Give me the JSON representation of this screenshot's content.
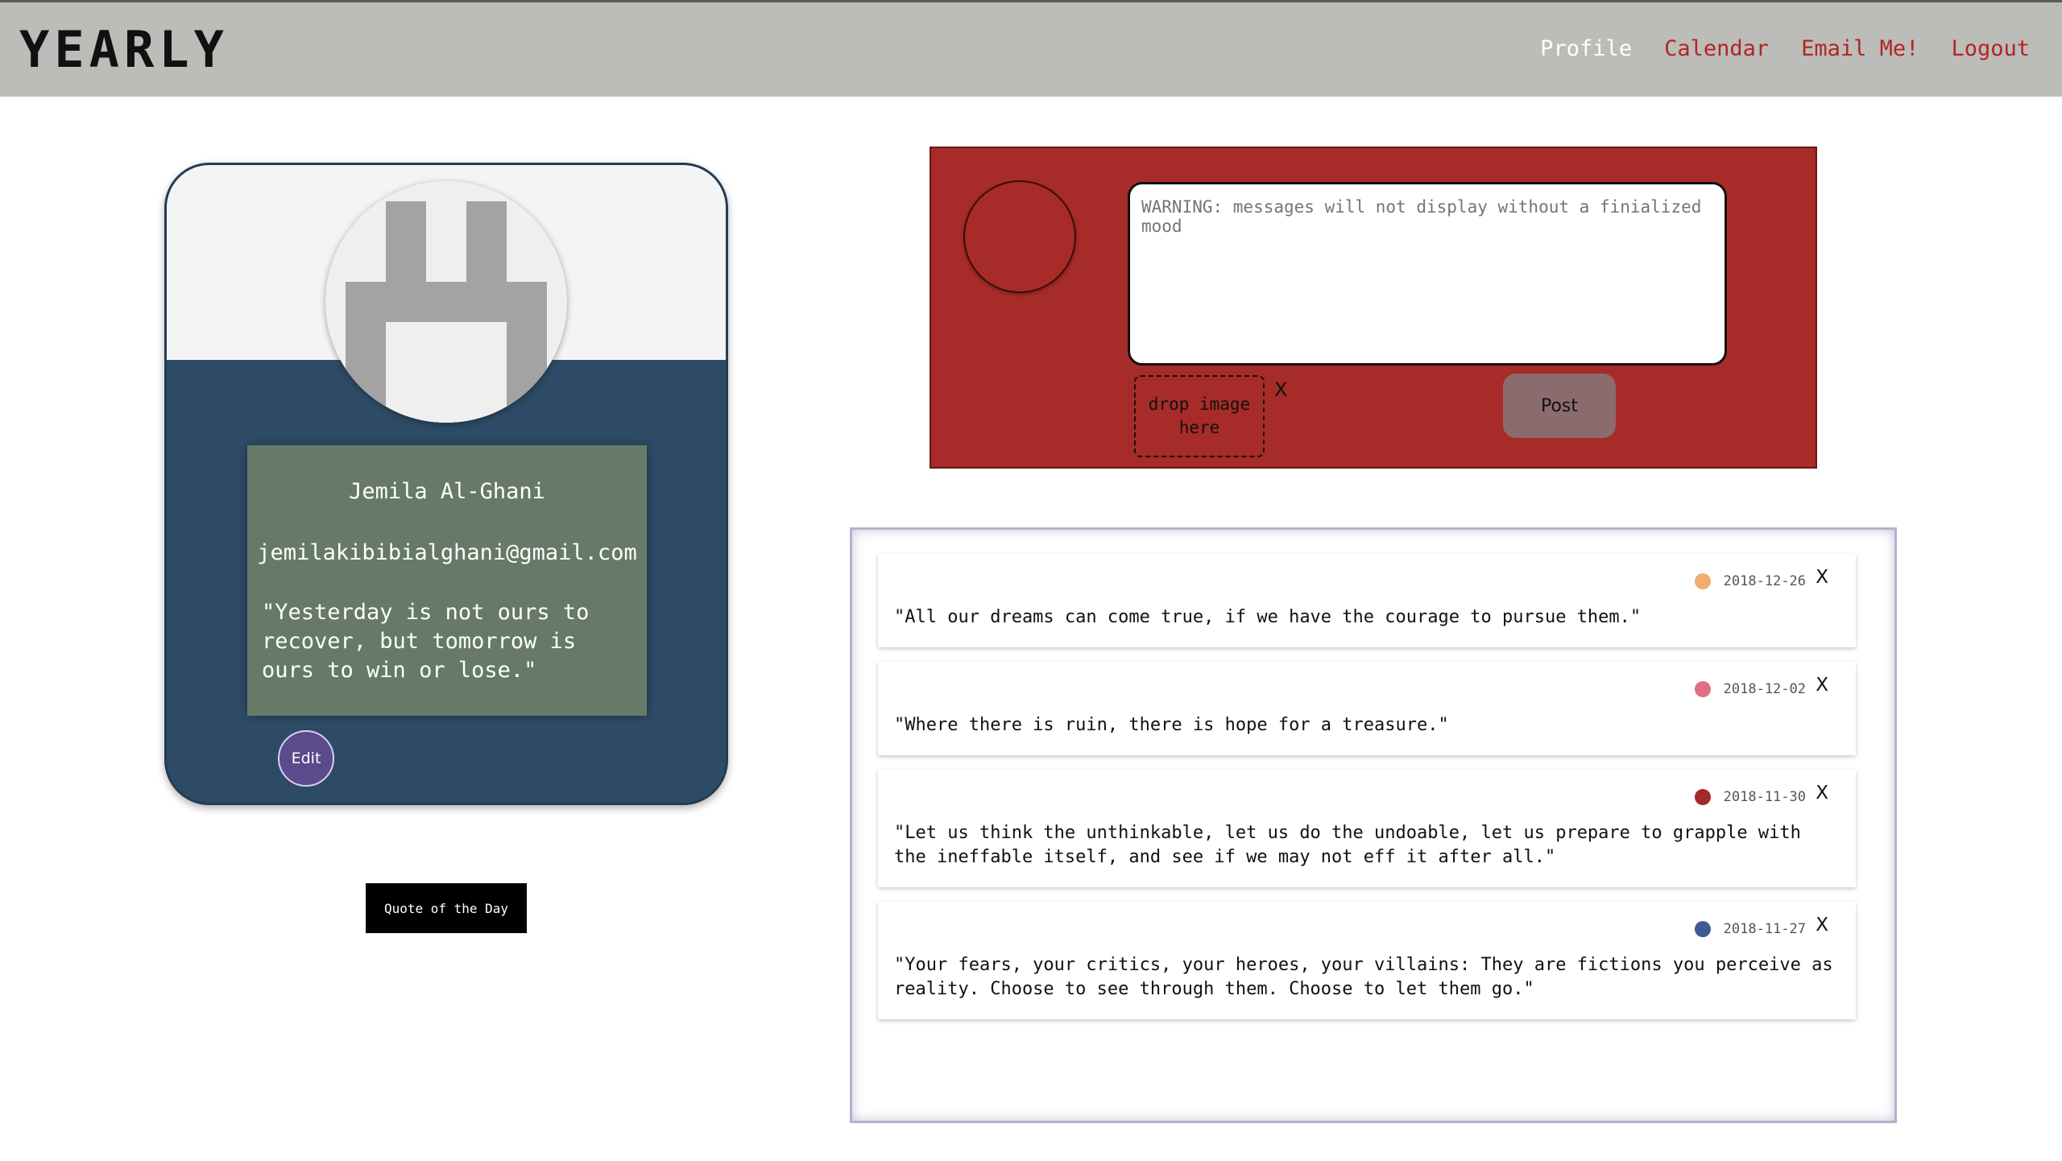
{
  "header": {
    "logo": "YEARLY",
    "nav": [
      {
        "label": "Profile",
        "active": true
      },
      {
        "label": "Calendar",
        "active": false
      },
      {
        "label": "Email Me!",
        "active": false
      },
      {
        "label": "Logout",
        "active": false
      }
    ]
  },
  "profile": {
    "avatar_icon": "pixel-plug-avatar-icon",
    "name": "Jemila Al-Ghani",
    "email": "jemilakibibialghani@gmail.com",
    "quote": "\"Yesterday is not ours to recover, but tomorrow is ours to win or lose.\"",
    "edit_label": "Edit",
    "quote_button": "Quote of the Day"
  },
  "composer": {
    "placeholder": "WARNING: messages will not display without a finialized mood",
    "drop_label": "drop image here",
    "remove_label": "X",
    "post_label": "Post"
  },
  "feed": [
    {
      "date": "2018-12-26",
      "mood_color": "#f2ab71",
      "text": "\"All our dreams can come true, if we have the courage to pursue them.\"",
      "close": "X"
    },
    {
      "date": "2018-12-02",
      "mood_color": "#e06f83",
      "text": "\"Where there is ruin, there is hope for a treasure.\"",
      "close": "X"
    },
    {
      "date": "2018-11-30",
      "mood_color": "#a3292b",
      "text": "\"Let us think the unthinkable, let us do the undoable, let us prepare to grapple with the ineffable itself, and see if we may not eff it after all.\"",
      "close": "X"
    },
    {
      "date": "2018-11-27",
      "mood_color": "#3e5a95",
      "text": "\"Your fears, your critics, your heroes, your villains: They are fictions you perceive as reality. Choose to see through them. Choose to let them go.\"",
      "close": "X"
    }
  ],
  "colors": {
    "header_bg": "#bcbcb8",
    "nav_link": "#b32525",
    "card_blue": "#2d4b66",
    "info_green": "#667a67",
    "composer_red": "#a72b28",
    "edit_purple": "#5b4a8c"
  }
}
